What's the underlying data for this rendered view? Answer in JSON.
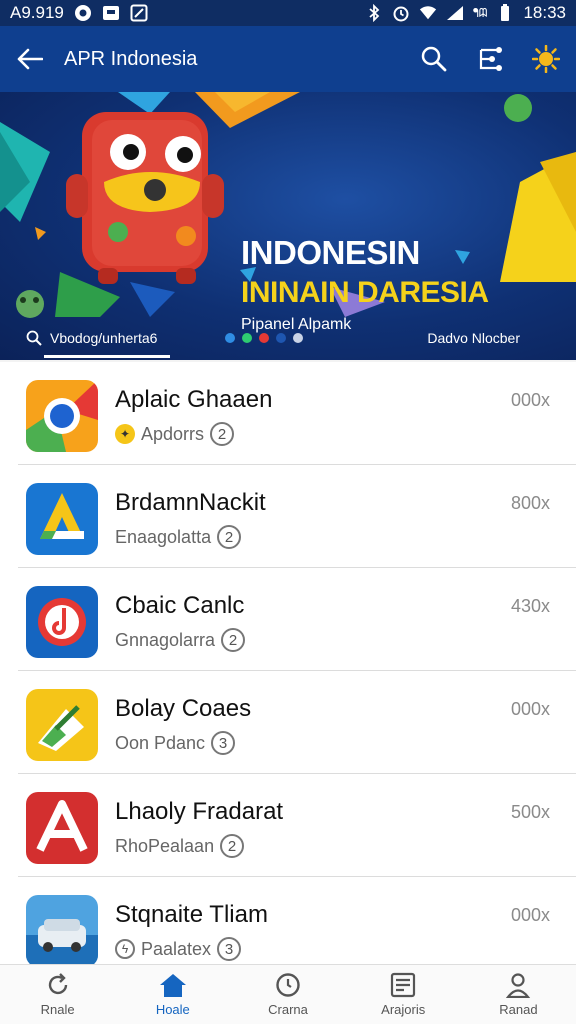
{
  "status_bar": {
    "time_left": "A9.919",
    "time_right": "18:33",
    "battery_text": "ᖳᗼ"
  },
  "app_bar": {
    "title": "APR Indonesia",
    "back_icon": "arrow-left-icon",
    "actions": [
      "search-icon",
      "share-icon",
      "sun-icon"
    ]
  },
  "banner": {
    "title_line1": "INDONESIN",
    "title_line2": "ININAIN DARESIA",
    "subtitle": "Pipanel Alpamk",
    "tab_left_label": "Vbodog/unherta6",
    "tab_right_label": "Dadvo Nlocber",
    "dot_colors": [
      "#2f8de4",
      "#2ecc71",
      "#e53935",
      "#1e56b0",
      "#c9d3e6"
    ]
  },
  "apps": [
    {
      "name": "Aplaic Ghaaen",
      "sub": "Apdorrs",
      "count": "2",
      "size": "000x",
      "has_badge": true
    },
    {
      "name": "BrdamnNackit",
      "sub": "Enaagolatta",
      "count": "2",
      "size": "800x",
      "has_badge": false
    },
    {
      "name": "Cbaic Canlc",
      "sub": "Gnnagolarra",
      "count": "2",
      "size": "430x",
      "has_badge": false
    },
    {
      "name": "Bolay Coaes",
      "sub": "Oon Pdanc",
      "count": "3",
      "size": "000x",
      "has_badge": false
    },
    {
      "name": "Lhaoly Fradarat",
      "sub": "RhoPealaan",
      "count": "2",
      "size": "500x",
      "has_badge": false
    },
    {
      "name": "Stqnaite Tliam",
      "sub": "Paalatex",
      "count": "3",
      "size": "000x",
      "has_badge": true
    }
  ],
  "bottom_nav": [
    {
      "label": "Rnale",
      "icon": "refresh-icon",
      "active": false
    },
    {
      "label": "Hoale",
      "icon": "home-icon",
      "active": true
    },
    {
      "label": "Crarna",
      "icon": "clock-icon",
      "active": false
    },
    {
      "label": "Arajoris",
      "icon": "list-icon",
      "active": false
    },
    {
      "label": "Ranad",
      "icon": "person-icon",
      "active": false
    }
  ],
  "colors": {
    "status_bar": "#0f2d63",
    "app_bar": "#0f3f8f",
    "accent": "#1565c0",
    "banner_yellow": "#f5d21b"
  }
}
